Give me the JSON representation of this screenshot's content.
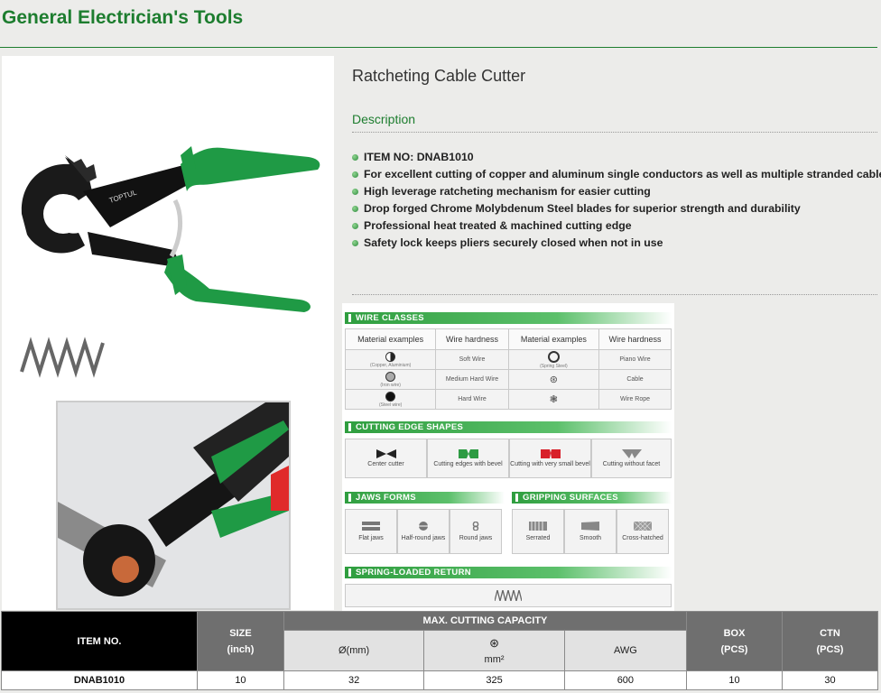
{
  "page": {
    "title": "General Electrician's Tools"
  },
  "product": {
    "name": "Ratcheting Cable Cutter",
    "description_heading": "Description",
    "features": [
      "ITEM NO: DNAB1010",
      "For excellent cutting of copper and aluminum single conductors as well as multiple stranded cables",
      "High leverage ratcheting mechanism for easier cutting",
      "Drop forged Chrome Molybdenum Steel blades for superior strength and durability",
      "Professional heat treated & machined cutting edge",
      "Safety lock keeps pliers securely closed when not in use"
    ],
    "brand_mark": "TOPTUL"
  },
  "spec_sheet": {
    "wire_classes": {
      "title": "WIRE CLASSES",
      "headers": [
        "Material examples",
        "Wire hardness",
        "Material examples",
        "Wire hardness"
      ],
      "rows": [
        {
          "m1": "(Copper, Aluminium)",
          "h1": "Soft Wire",
          "m2": "(Spring Steel)",
          "h2": "Piano Wire"
        },
        {
          "m1": "(Iron wire)",
          "h1": "Medium Hard Wire",
          "m2": "",
          "h2": "Cable"
        },
        {
          "m1": "(Steel wire)",
          "h1": "Hard Wire",
          "m2": "",
          "h2": "Wire Rope"
        }
      ]
    },
    "cutting_edge": {
      "title": "CUTTING EDGE SHAPES",
      "items": [
        "Center cutter",
        "Cutting edges with bevel",
        "Cutting with very small bevel",
        "Cutting without facet"
      ],
      "colors": [
        "#222222",
        "#2e9b43",
        "#d8202a",
        "#888888"
      ]
    },
    "jaws": {
      "title": "JAWS FORMS",
      "items": [
        "Flat jaws",
        "Half-round jaws",
        "Round jaws"
      ]
    },
    "gripping": {
      "title": "GRIPPING SURFACES",
      "items": [
        "Serrated",
        "Smooth",
        "Cross-hatched"
      ]
    },
    "spring": {
      "title": "SPRING-LOADED RETURN"
    }
  },
  "table": {
    "headers": {
      "item_no": "ITEM NO.",
      "size": "SIZE",
      "size_unit": "(inch)",
      "capacity": "MAX. CUTTING CAPACITY",
      "diameter": "Ø(mm)",
      "mm2": "mm²",
      "awg": "AWG",
      "box": "BOX",
      "box_unit": "(PCS)",
      "ctn": "CTN",
      "ctn_unit": "(PCS)"
    },
    "rows": [
      {
        "item_no": "DNAB1010",
        "size": "10",
        "diameter": "32",
        "mm2": "325",
        "awg": "600",
        "box": "10",
        "ctn": "30"
      }
    ]
  },
  "colors": {
    "brand_green": "#1d7d2f",
    "handle_green": "#1f9a45"
  }
}
